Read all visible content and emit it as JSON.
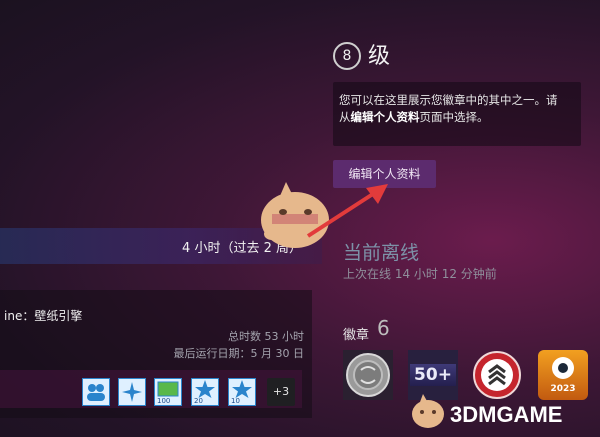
{
  "profile": {
    "level": "8",
    "level_suffix": "级",
    "badge_tip": {
      "line1": "您可以在这里展示您徽章中的其中之一。请",
      "line2_prefix": "从",
      "line2_bold": "编辑个人资料",
      "line2_suffix": "页面中选择。"
    },
    "edit_button": "编辑个人资料",
    "status": "当前离线",
    "last_online": "上次在线 14 小时 12 分钟前",
    "badges_label": "徽章",
    "badges_count": "6"
  },
  "activity": {
    "recent_hours": "4 小时（过去 2 周）",
    "game": {
      "name": "ine：壁纸引擎",
      "total_hours": "总时数 53 小时",
      "last_played": "最后运行日期：5 月 30 日"
    },
    "achievements": [
      {
        "icon": "group-icon",
        "label": ""
      },
      {
        "icon": "sparkle-icon",
        "label": ""
      },
      {
        "icon": "image-icon",
        "label": "100"
      },
      {
        "icon": "star-icon",
        "label": "20"
      },
      {
        "icon": "star-icon",
        "label": "10"
      }
    ],
    "more_label": "+3"
  },
  "badges": [
    {
      "icon": "silver-coin-badge-icon"
    },
    {
      "icon": "level-50-badge-icon",
      "text": "50+"
    },
    {
      "icon": "rank-shield-badge-icon"
    },
    {
      "icon": "steam-2023-badge-icon",
      "text": "2023"
    }
  ],
  "watermark": {
    "text": "3DMGAME"
  },
  "colors": {
    "edit_button_bg": "#5c2b6e",
    "status_offline": "#7d92a8",
    "arrow": "#e23b3b"
  }
}
